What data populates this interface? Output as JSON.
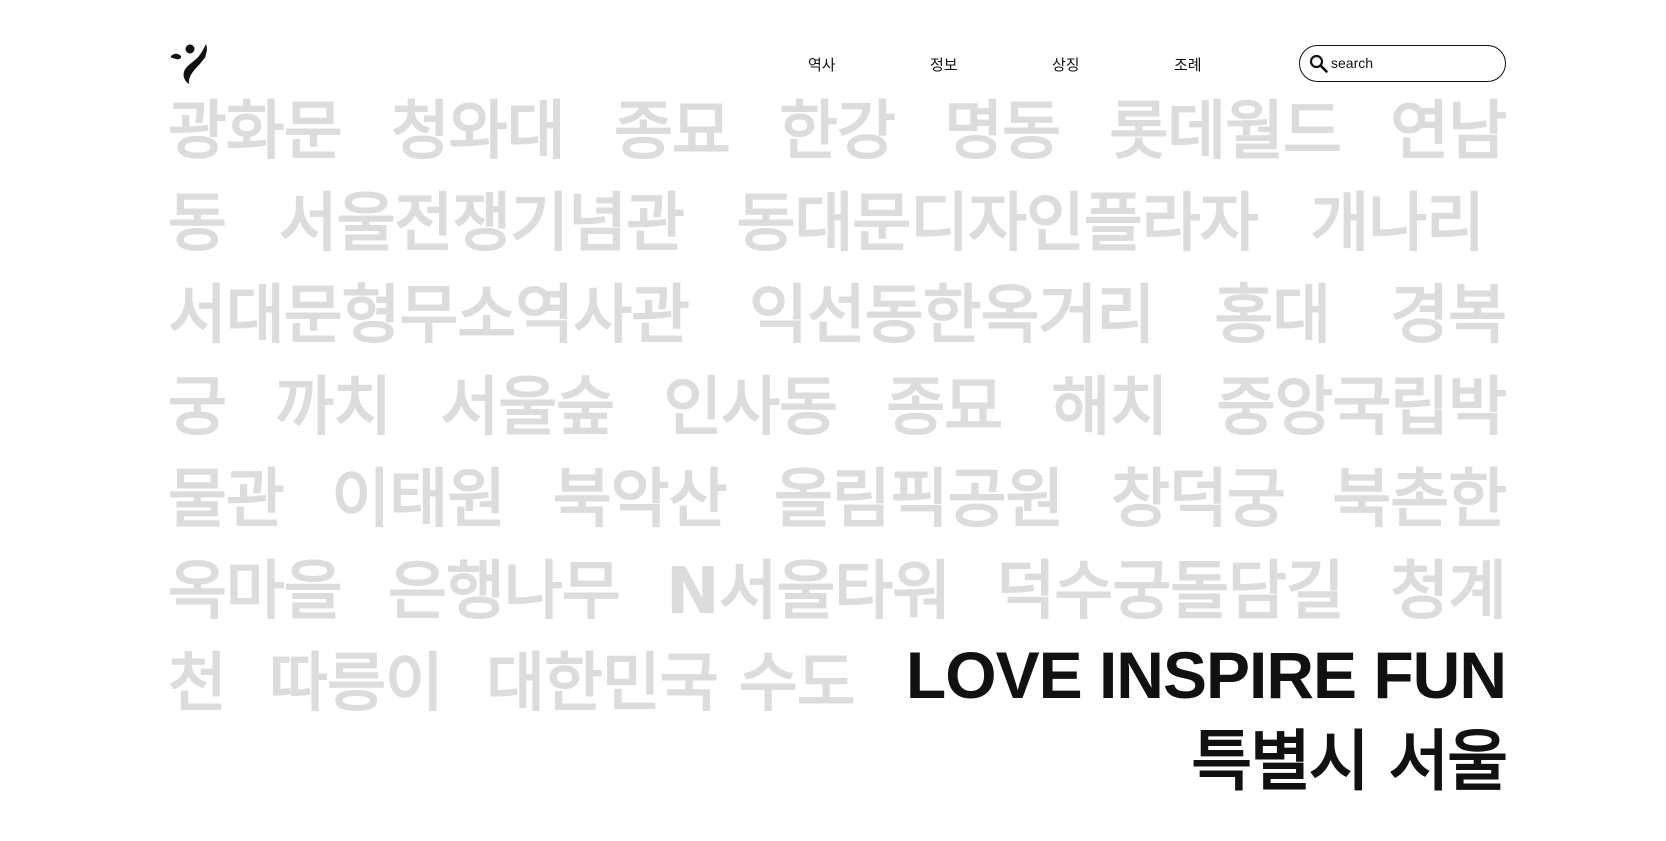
{
  "header": {
    "logo_icon": "seoul-logo-icon",
    "nav": [
      {
        "label": "역사"
      },
      {
        "label": "정보"
      },
      {
        "label": "상징"
      },
      {
        "label": "조례"
      }
    ],
    "search": {
      "placeholder": "search",
      "value": "",
      "icon": "search-icon"
    }
  },
  "places": [
    "광화문",
    "청와대",
    "종묘",
    "한강",
    "명동",
    "롯데월드",
    "연남동",
    "서울전쟁기념관",
    "동대문디자인플라자",
    "개나리",
    "서대문형무소역사관",
    "익선동한옥거리",
    "홍대",
    "경복궁",
    "까치",
    "서울숲",
    "인사동",
    "종묘",
    "해치",
    "중앙국립박물관",
    "이태원",
    "북악산",
    "올림픽공원",
    "창덕궁",
    "북촌한옥마을",
    "은행나무",
    "N서울타워",
    "덕수궁돌담길",
    "청계천",
    "따릉이",
    "대한민국 수도"
  ],
  "tagline": "LOVE INSPIRE FUN",
  "city_name": "특별시 서울",
  "colors": {
    "text": "#111111",
    "place_text": "#dcdcdc",
    "background": "#ffffff"
  }
}
